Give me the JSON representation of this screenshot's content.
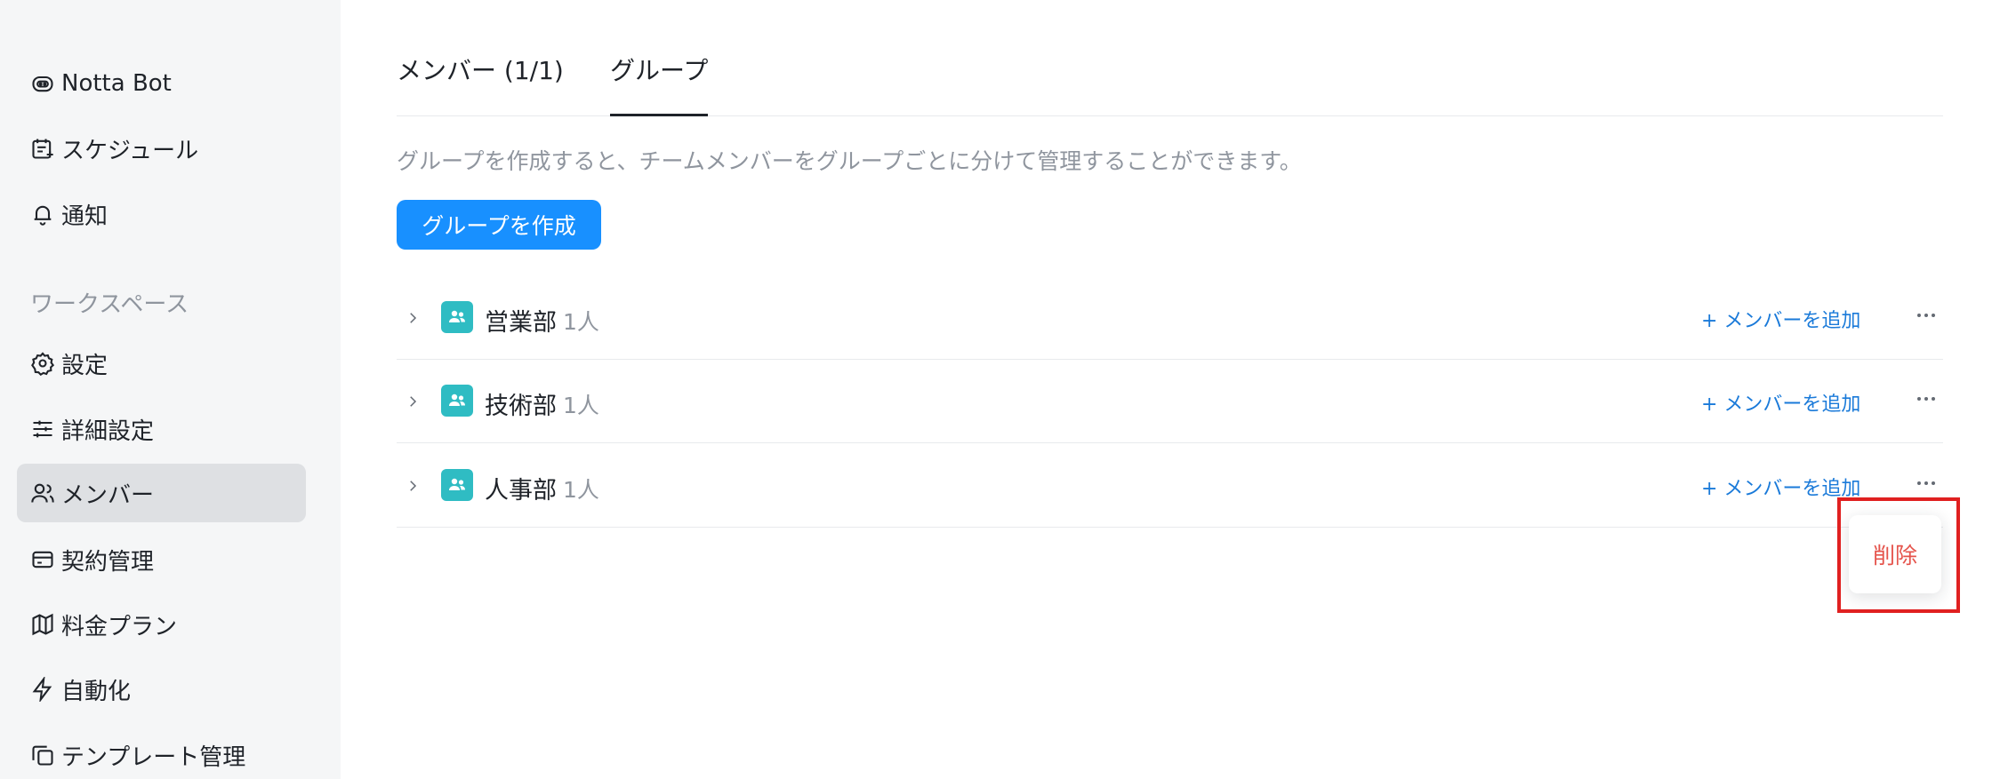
{
  "sidebar": {
    "top_items": [
      {
        "label": "Notta Bot",
        "icon": "bot-icon"
      },
      {
        "label": "スケジュール",
        "icon": "calendar-icon"
      },
      {
        "label": "通知",
        "icon": "bell-icon"
      }
    ],
    "section_label": "ワークスペース",
    "workspace_items": [
      {
        "label": "設定",
        "icon": "gear-icon"
      },
      {
        "label": "詳細設定",
        "icon": "sliders-icon"
      },
      {
        "label": "メンバー",
        "icon": "users-icon",
        "active": true
      },
      {
        "label": "契約管理",
        "icon": "card-icon"
      },
      {
        "label": "料金プラン",
        "icon": "map-icon"
      },
      {
        "label": "自動化",
        "icon": "bolt-icon"
      },
      {
        "label": "テンプレート管理",
        "icon": "template-icon"
      }
    ]
  },
  "main": {
    "tabs": [
      {
        "label": "メンバー (1/1)",
        "active": false
      },
      {
        "label": "グループ",
        "active": true
      }
    ],
    "description": "グループを作成すると、チームメンバーをグループごとに分けて管理することができます。",
    "create_button": "グループを作成",
    "groups": [
      {
        "name": "営業部",
        "count": "1人",
        "add_label": "+ メンバーを追加"
      },
      {
        "name": "技術部",
        "count": "1人",
        "add_label": "+ メンバーを追加"
      },
      {
        "name": "人事部",
        "count": "1人",
        "add_label": "+ メンバーを追加"
      }
    ]
  },
  "dropdown": {
    "delete_label": "削除"
  },
  "colors": {
    "primary": "#1890ff",
    "link": "#1a7ad9",
    "group_icon": "#2fbcc3",
    "danger": "#e5534b",
    "highlight": "#e02020",
    "sidebar_bg": "#f5f6f7",
    "active_bg": "#dee0e3"
  }
}
